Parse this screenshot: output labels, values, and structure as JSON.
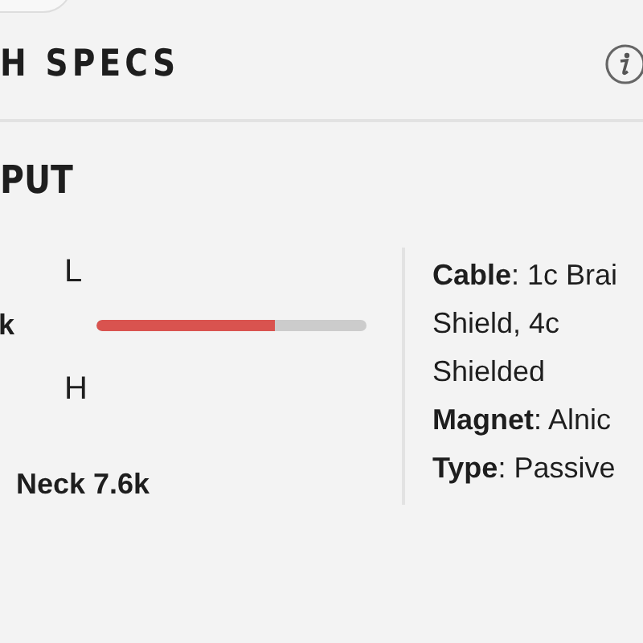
{
  "header": {
    "title": "H SPECS"
  },
  "section": {
    "title": "PUT"
  },
  "output": {
    "edge_value": "k",
    "low_label": "L",
    "high_label": "H",
    "level": 0.66,
    "neck": "Neck 7.6k"
  },
  "specs": [
    "**Cable**: 1c Brai",
    "Shield, 4c",
    "Shielded",
    "**Magnet**: Alnic",
    "**Type**: Passive"
  ]
}
